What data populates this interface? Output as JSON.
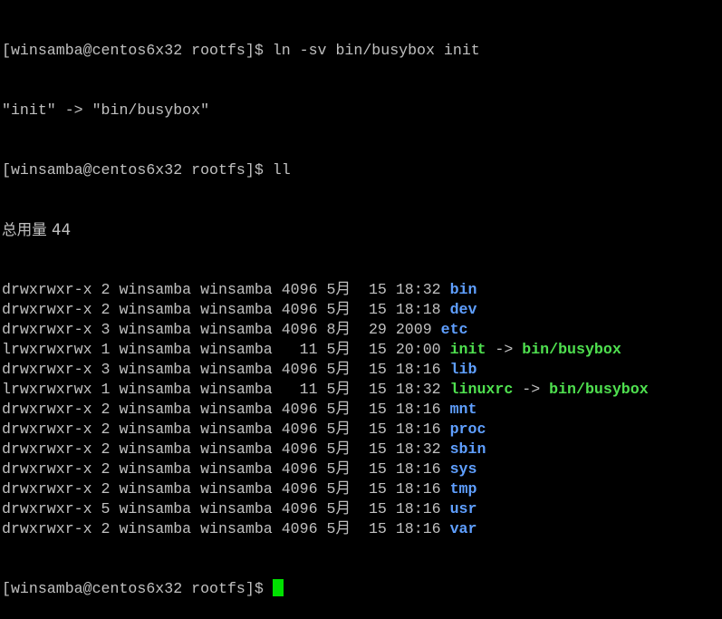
{
  "colors": {
    "background": "#000000",
    "text": "#c0c0c0",
    "directory": "#5f9fff",
    "symlink": "#4fe04f",
    "cursor": "#00e000"
  },
  "prompt": "[winsamba@centos6x32 rootfs]$",
  "lines": {
    "cmd1": "[winsamba@centos6x32 rootfs]$ ln -sv bin/busybox init",
    "out1": "\"init\" -> \"bin/busybox\"",
    "cmd2": "[winsamba@centos6x32 rootfs]$ ll",
    "total": "总用量 44"
  },
  "entries": [
    {
      "meta": "drwxrwxr-x 2 winsamba winsamba 4096 5月  15 18:32 ",
      "name": "bin",
      "kind": "dir",
      "target": ""
    },
    {
      "meta": "drwxrwxr-x 2 winsamba winsamba 4096 5月  15 18:18 ",
      "name": "dev",
      "kind": "dir",
      "target": ""
    },
    {
      "meta": "drwxrwxr-x 3 winsamba winsamba 4096 8月  29 2009 ",
      "name": "etc",
      "kind": "dir",
      "target": ""
    },
    {
      "meta": "lrwxrwxrwx 1 winsamba winsamba   11 5月  15 20:00 ",
      "name": "init",
      "kind": "link",
      "target": "bin/busybox"
    },
    {
      "meta": "drwxrwxr-x 3 winsamba winsamba 4096 5月  15 18:16 ",
      "name": "lib",
      "kind": "dir",
      "target": ""
    },
    {
      "meta": "lrwxrwxrwx 1 winsamba winsamba   11 5月  15 18:32 ",
      "name": "linuxrc",
      "kind": "link",
      "target": "bin/busybox"
    },
    {
      "meta": "drwxrwxr-x 2 winsamba winsamba 4096 5月  15 18:16 ",
      "name": "mnt",
      "kind": "dir",
      "target": ""
    },
    {
      "meta": "drwxrwxr-x 2 winsamba winsamba 4096 5月  15 18:16 ",
      "name": "proc",
      "kind": "dir",
      "target": ""
    },
    {
      "meta": "drwxrwxr-x 2 winsamba winsamba 4096 5月  15 18:32 ",
      "name": "sbin",
      "kind": "dir",
      "target": ""
    },
    {
      "meta": "drwxrwxr-x 2 winsamba winsamba 4096 5月  15 18:16 ",
      "name": "sys",
      "kind": "dir",
      "target": ""
    },
    {
      "meta": "drwxrwxr-x 2 winsamba winsamba 4096 5月  15 18:16 ",
      "name": "tmp",
      "kind": "dir",
      "target": ""
    },
    {
      "meta": "drwxrwxr-x 5 winsamba winsamba 4096 5月  15 18:16 ",
      "name": "usr",
      "kind": "dir",
      "target": ""
    },
    {
      "meta": "drwxrwxr-x 2 winsamba winsamba 4096 5月  15 18:16 ",
      "name": "var",
      "kind": "dir",
      "target": ""
    }
  ],
  "link_arrow": " -> ",
  "final_prompt": "[winsamba@centos6x32 rootfs]$"
}
